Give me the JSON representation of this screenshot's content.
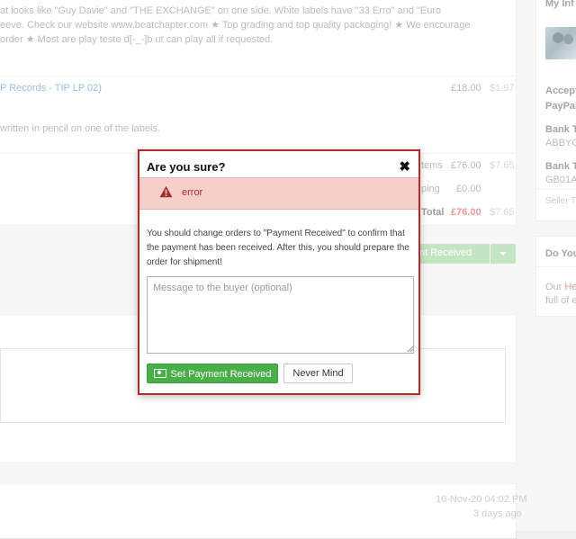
{
  "background": {
    "description_lines": [
      "at looks like \"Guy Davie\" and \"THE EXCHANGE\" on one side. White labels have \"33 Erro\" and \"Euro",
      "eeve. Check our website www.beatchapter.com ★ Top grading and top quality packaging! ★ We encourage",
      "order ★ Most are play teste d[-_-]b ut can play all if requested."
    ],
    "item_title": "P Records - TIP LP 02)",
    "item_price": "£18.00",
    "item_price_alt": "$1.97",
    "item_note": "written in pencil on one of the labels.",
    "summary": [
      {
        "label": "tems",
        "value": "£76.00",
        "alt": "$7.65"
      },
      {
        "label": "ping",
        "value": "£0.00",
        "alt": ""
      },
      {
        "label": "Total",
        "value": "£76.00",
        "alt": "$7.65"
      }
    ],
    "status_button": "nt Received",
    "timestamp": "16-Nov-20 04:02 PM",
    "relative_time": "3 days ago",
    "sidebar": {
      "my_info": "My Inf",
      "accept": "Accept",
      "paypal": "PayPal",
      "bank1": "Bank T",
      "bank1_val": "ABBYG",
      "bank2": "Bank T",
      "bank2_val": "GB01A",
      "seller": "Seller T",
      "do_you": "Do You",
      "our_he_prefix": "Our ",
      "our_he_link": "He",
      "our_he_cont": "full of e"
    },
    "colors": {
      "total_red": "#d9534f",
      "green": "#4aae49",
      "link": "#4a90c8"
    }
  },
  "modal": {
    "title": "Are you sure?",
    "close_symbol": "✖",
    "alert_icon": "warning-icon",
    "alert_text": "error",
    "body_text": "You should change orders to \"Payment Received\" to confirm that the payment has been received. After this, you should prepare the order for shipment!",
    "message_placeholder": "Message to the buyer (optional)",
    "confirm_label": "Set Payment Received",
    "confirm_icon": "money-icon",
    "cancel_label": "Never Mind",
    "colors": {
      "border": "#b7282e",
      "alert_bg": "#f6cfcb",
      "confirm_bg": "#4aae49"
    }
  }
}
